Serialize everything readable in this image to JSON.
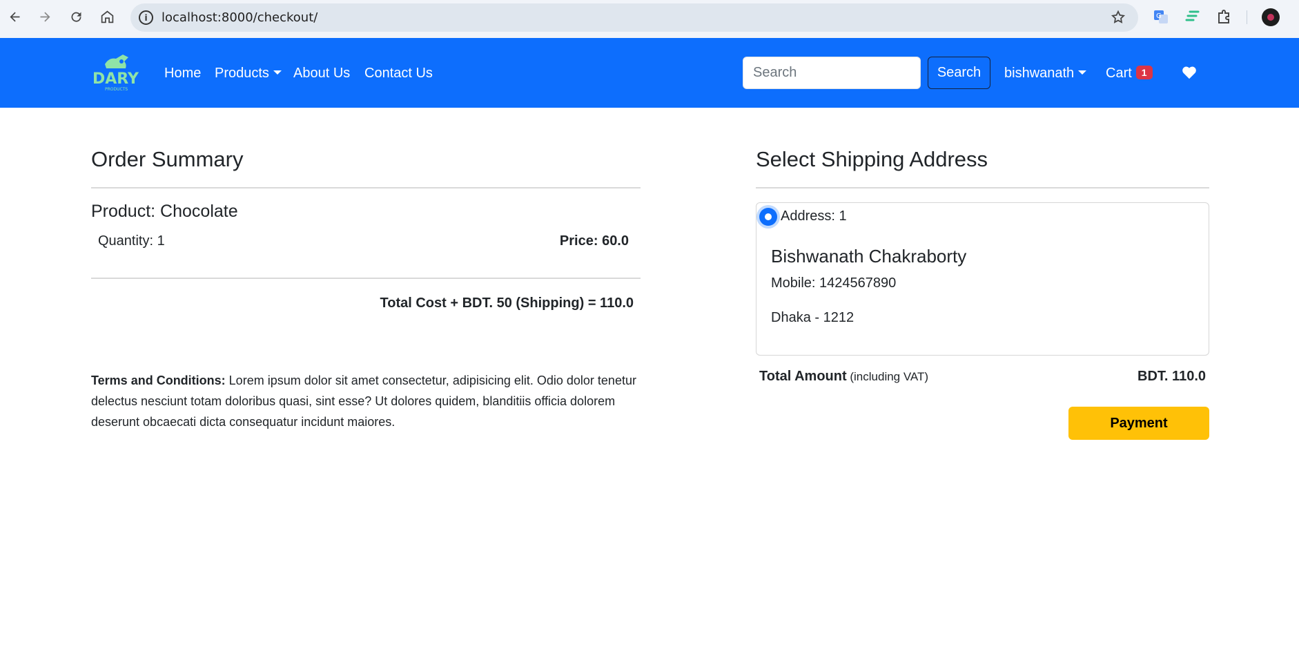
{
  "browser": {
    "url": "localhost:8000/checkout/"
  },
  "navbar": {
    "brand": "DARY",
    "brand_sub": "PRODUCTS",
    "links": {
      "home": "Home",
      "products": "Products",
      "about": "About Us",
      "contact": "Contact Us"
    },
    "search_placeholder": "Search",
    "search_button": "Search",
    "user": "bishwanath",
    "cart_label": "Cart",
    "cart_count": "1"
  },
  "order": {
    "heading": "Order Summary",
    "product": "Product: Chocolate",
    "quantity": "Quantity: 1",
    "price": "Price: 60.0",
    "total_cost": "Total Cost + BDT. 50 (Shipping) = 110.0",
    "terms_label": "Terms and Conditions:",
    "terms_text": " Lorem ipsum dolor sit amet consectetur, adipisicing elit. Odio dolor tenetur delectus nesciunt totam doloribus quasi, sint esse? Ut dolores quidem, blanditiis officia dolorem deserunt obcaecati dicta consequatur incidunt maiores."
  },
  "shipping": {
    "heading": "Select Shipping Address",
    "address_label": "Address: 1",
    "name": "Bishwanath Chakraborty",
    "mobile": "Mobile: 1424567890",
    "city": "Dhaka - 1212",
    "total_label": "Total Amount",
    "total_sub": " (including VAT)",
    "total_value": "BDT. 110.0",
    "payment_button": "Payment"
  },
  "colors": {
    "primary": "#0d6efd",
    "warning": "#ffc107",
    "danger": "#dc3545"
  }
}
